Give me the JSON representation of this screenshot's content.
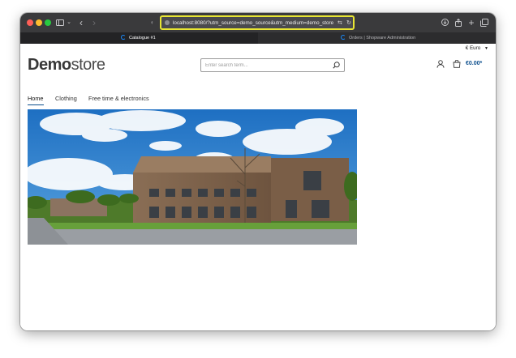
{
  "browser": {
    "url": "localhost:8080/?utm_source=demo_source&utm_medium=demo_store",
    "tabs": [
      {
        "label": "Catalogue #1",
        "active": true
      },
      {
        "label": "Orders | Shopware Administration",
        "active": false
      }
    ]
  },
  "store": {
    "currency": "€ Euro",
    "logo_bold": "Demo",
    "logo_light": "store",
    "search_placeholder": "Enter search term...",
    "cart_total": "€0.00*",
    "nav": [
      "Home",
      "Clothing",
      "Free time & electronics"
    ]
  },
  "colors": {
    "accent": "#0a4d8c",
    "url_highlight": "#e9e633"
  },
  "icons": [
    "sidebar-icon",
    "back-icon",
    "forward-icon",
    "download-icon",
    "share-icon",
    "new-tab-icon",
    "tab-overview-icon",
    "search-icon",
    "account-icon",
    "cart-icon"
  ]
}
